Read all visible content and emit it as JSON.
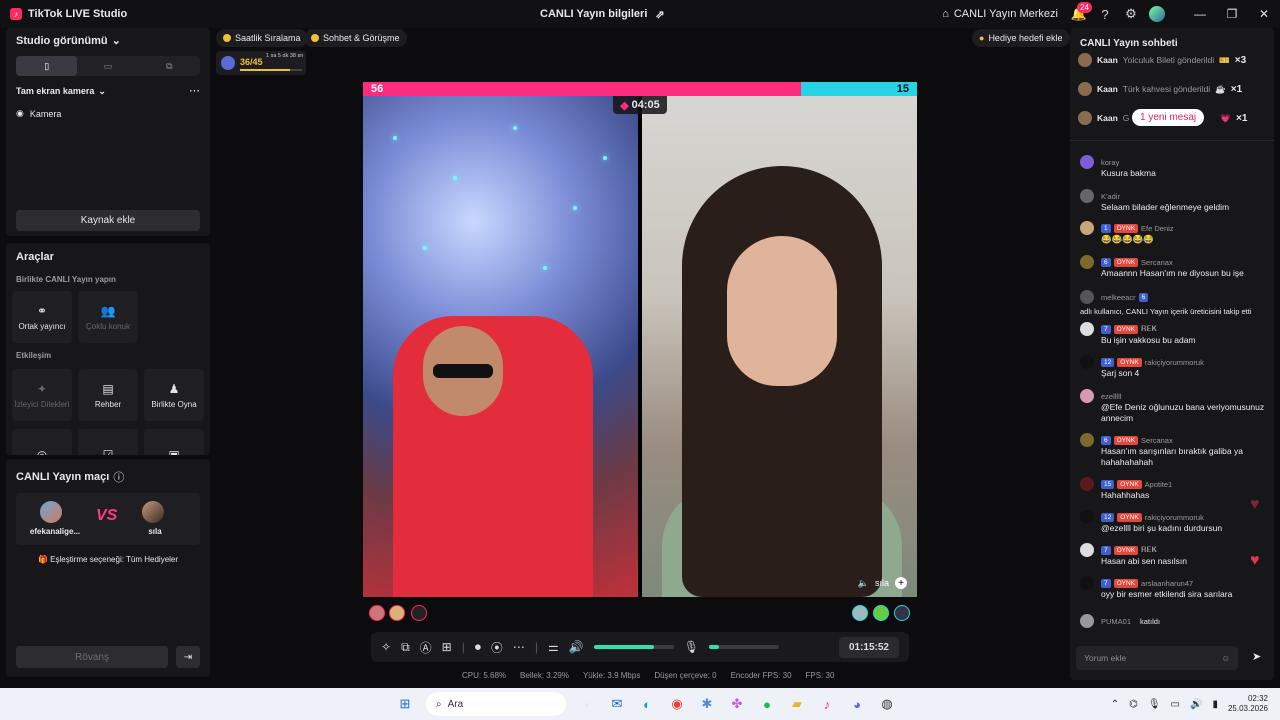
{
  "titlebar": {
    "app_name": "TikTok LIVE Studio",
    "center_title": "CANLI Yayın bilgileri",
    "live_center": "CANLI Yayın Merkezi",
    "notification_count": "24"
  },
  "left": {
    "studio_view": "Studio görünümü",
    "fullscreen_camera": "Tam ekran kamera",
    "camera_source": "Kamera",
    "add_source": "Kaynak ekle",
    "tools_title": "Araçlar",
    "live_together": "Birlikte CANLI Yayın yapın",
    "co_host": "Ortak yayıncı",
    "multi_guest": "Çoklu konuk",
    "interaction": "Etkileşim",
    "viewer_wishes": "İzleyici Dilekleri",
    "guide": "Rehber",
    "play_together": "Birlikte Oyna",
    "match_title": "CANLI Yayın maçı",
    "player1": "efekanaligе...",
    "player2": "sıla",
    "vs": "VS",
    "match_option": "Eşleştirme seçeneği: Tüm Hediyeler",
    "rematch": "Rövanş"
  },
  "top": {
    "hourly_rank": "Saatlik Sıralama",
    "chat_meet": "Sohbet & Görüşme",
    "progress": "36/45",
    "progress_fraction": 0.8,
    "progress_time": "1 sa 5 dk 38 sn",
    "gift_goal": "Hediye hedefi ekle"
  },
  "battle": {
    "score_left": "56",
    "score_right": "15",
    "pink_share": 0.79,
    "timer": "04:05",
    "right_name": "sıla"
  },
  "controls": {
    "volume_level": 0.75,
    "mic_level": 0.15,
    "elapsed": "01:15:52"
  },
  "stats": {
    "cpu": "CPU:  5.68%",
    "memory": "Bellek:  3.29%",
    "upload": "Yükle:  3.9 Mbps",
    "dropped": "Düşen çerçeve:  0",
    "encoder": "Encoder FPS:  30",
    "fps": "FPS:  30"
  },
  "chat": {
    "title": "CANLI Yayın sohbeti",
    "gifts": [
      {
        "name": "Kaan",
        "action": "Yolculuk Bileti gönderildi",
        "count": "×3"
      },
      {
        "name": "Kaan",
        "action": "Türk kahvesi gönderildi",
        "count": "×1"
      },
      {
        "name": "Kaan",
        "action": "G",
        "count": "×1"
      }
    ],
    "new_message": "1 yeni mesaj",
    "messages": [
      {
        "user": "koray",
        "text": "Kusura bakma"
      },
      {
        "user": "K'adir",
        "text": "Selaam bilader eğlenmeye geldim"
      },
      {
        "level": "1",
        "tag": "OYNK",
        "user": "Efe Deniz",
        "text": "😂😂😂😂😂"
      },
      {
        "level": "6",
        "tag": "OYNK",
        "user": "Sercanax",
        "text": "Amaannn Hasan'ım ne diyosun bu işe"
      },
      {
        "user": "melkeeacr",
        "level": "6",
        "text": "adlı kullanıcı, CANLI Yayın içerik üreticisini takip etti"
      },
      {
        "level": "7",
        "tag": "OYNK",
        "user": "𝐑𝐄𝐊",
        "text": "Bu işin vakkosu bu adam"
      },
      {
        "level": "12",
        "tag": "OYNK",
        "user": "rakiçiyorummoruk",
        "text": "Şarj son 4"
      },
      {
        "user": "ezelllll",
        "text": "@Efe Deniz oğlunuzu bana veriyomusunuz annecim"
      },
      {
        "level": "6",
        "tag": "OYNK",
        "user": "Sercanax",
        "text": "Hasan'ım sarışınları bıraktık galiba ya hahahahahah"
      },
      {
        "level": "15",
        "tag": "OYNK",
        "user": "Apotite1",
        "text": "Hahahhahas"
      },
      {
        "level": "12",
        "tag": "OYNK",
        "user": "rakiçiyorummoruk",
        "text": "@ezellll biri şu kadını durdursun"
      },
      {
        "level": "7",
        "tag": "OYNK",
        "user": "𝐑𝐄𝐊",
        "text": "Hasan abi sen nasılsın"
      },
      {
        "level": "7",
        "tag": "OYNK",
        "user": "arslaanharun47",
        "text": "oyy bir esmer etkilendi sira sarılara"
      },
      {
        "user": "PUMA01",
        "text": "katıldı"
      }
    ],
    "input_placeholder": "Yorum ekle"
  },
  "taskbar": {
    "search": "Ara",
    "time": "02:32",
    "date": "25.03.2026"
  }
}
